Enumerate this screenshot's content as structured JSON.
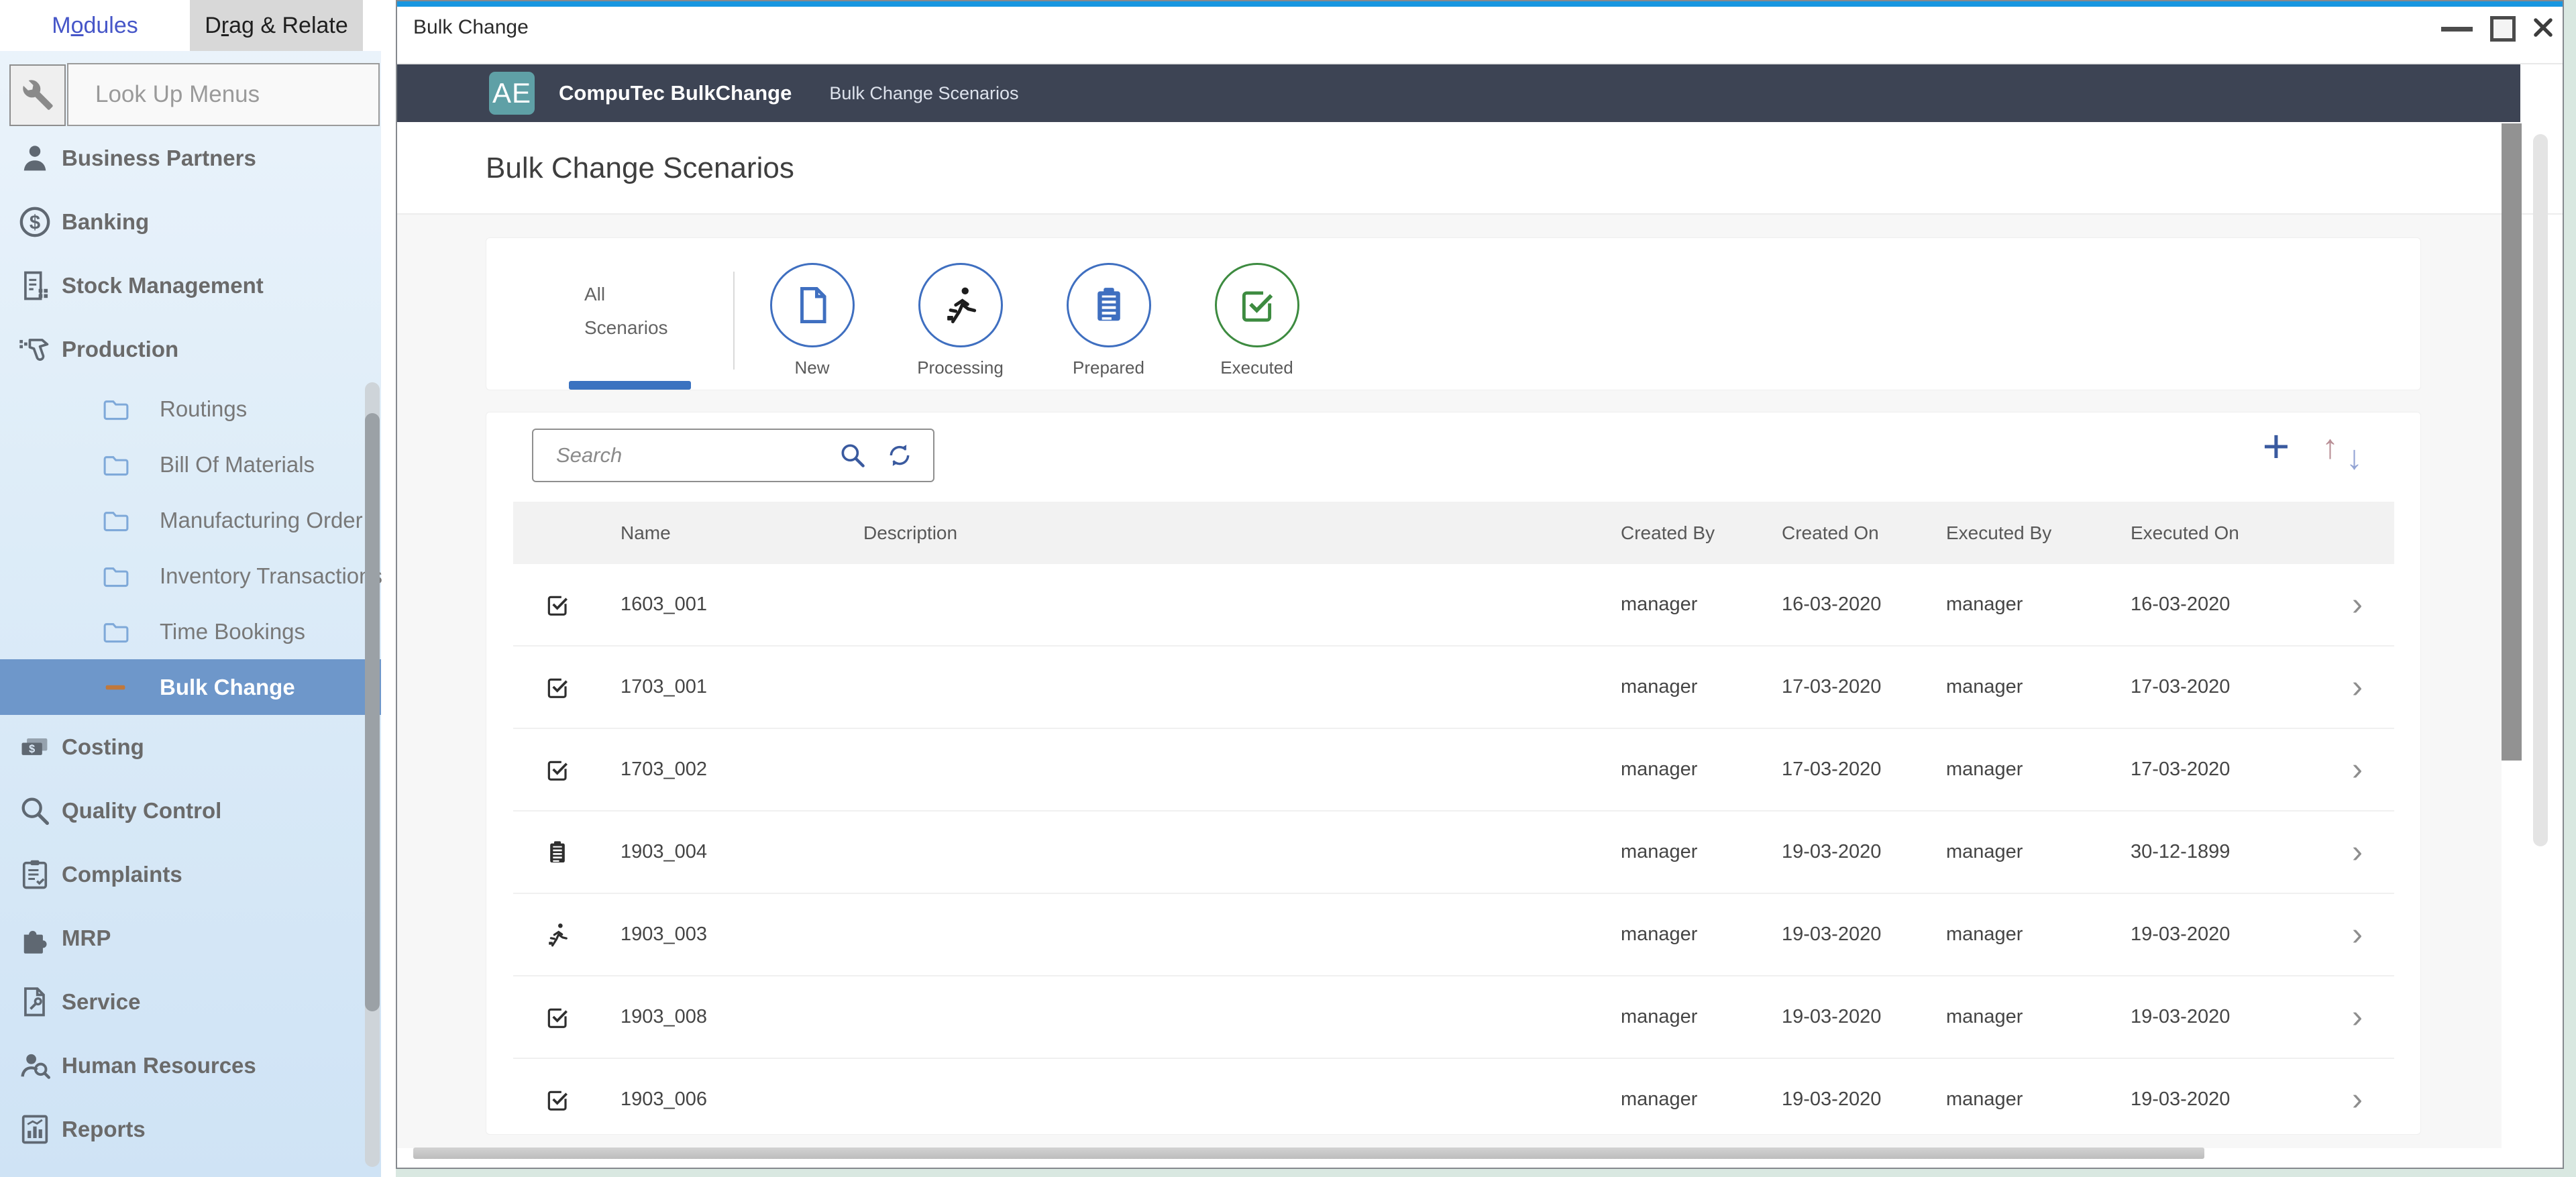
{
  "colors": {
    "accent_blue": "#1896e0",
    "header_dark": "#3d4454",
    "badge_teal": "#5fa0a6",
    "selected_item": "#6e97ca",
    "tab_blue": "#3f6fc0",
    "tab_green": "#3d8b40",
    "active_underline": "#3a72c0",
    "icon_navy": "#3a5a9f",
    "dash_orange": "#c0783c",
    "sidebar_top": "#ecf4fb",
    "sidebar_bottom": "#cfe3f5"
  },
  "sidebar": {
    "tabs": [
      {
        "pre": "M",
        "accel": "o",
        "post": "dules",
        "active": true
      },
      {
        "pre": "D",
        "accel": "r",
        "post": "ag & Relate",
        "active": false
      }
    ],
    "lookup_placeholder": "Look Up Menus",
    "items": [
      {
        "label": "Business Partners",
        "icon": "person",
        "type": "module"
      },
      {
        "label": "Banking",
        "icon": "dollar",
        "type": "module"
      },
      {
        "label": "Stock Management",
        "icon": "stock",
        "type": "module"
      },
      {
        "label": "Production",
        "icon": "production",
        "type": "module"
      },
      {
        "label": "Routings",
        "icon": "folder",
        "type": "sub"
      },
      {
        "label": "Bill Of Materials",
        "icon": "folder",
        "type": "sub"
      },
      {
        "label": "Manufacturing Order",
        "icon": "folder",
        "type": "sub"
      },
      {
        "label": "Inventory Transactions",
        "icon": "folder",
        "type": "sub"
      },
      {
        "label": "Time Bookings",
        "icon": "folder",
        "type": "sub"
      },
      {
        "label": "Bulk Change",
        "icon": "dash",
        "type": "sub",
        "selected": true
      },
      {
        "label": "Costing",
        "icon": "money",
        "type": "module"
      },
      {
        "label": "Quality Control",
        "icon": "magnifier",
        "type": "module"
      },
      {
        "label": "Complaints",
        "icon": "clipboard",
        "type": "module"
      },
      {
        "label": "MRP",
        "icon": "puzzle",
        "type": "module"
      },
      {
        "label": "Service",
        "icon": "service",
        "type": "module"
      },
      {
        "label": "Human Resources",
        "icon": "person-search",
        "type": "module"
      },
      {
        "label": "Reports",
        "icon": "report",
        "type": "module"
      }
    ]
  },
  "window": {
    "title": "Bulk Change",
    "header": {
      "badge": "AE",
      "app_name": "CompuTec BulkChange",
      "breadcrumb": "Bulk Change Scenarios"
    },
    "page_title": "Bulk Change Scenarios",
    "filter_bar": {
      "all_tab": {
        "line1": "All",
        "line2": "Scenarios"
      },
      "tabs": [
        {
          "label": "New",
          "icon": "document",
          "color": "blue"
        },
        {
          "label": "Processing",
          "icon": "runner",
          "color": "blue"
        },
        {
          "label": "Prepared",
          "icon": "clipboard-filled",
          "color": "blue"
        },
        {
          "label": "Executed",
          "icon": "check-square",
          "color": "green"
        }
      ]
    },
    "toolbar": {
      "search_placeholder": "Search",
      "add_icon": "+",
      "sort_up_icon": "↑",
      "sort_down_icon": "↓"
    },
    "table": {
      "columns": [
        "Name",
        "Description",
        "Created By",
        "Created On",
        "Executed By",
        "Executed On"
      ],
      "chevron_icon": "›",
      "rows": [
        {
          "status": "executed",
          "name": "1603_001",
          "description": "",
          "created_by": "manager",
          "created_on": "16-03-2020",
          "executed_by": "manager",
          "executed_on": "16-03-2020"
        },
        {
          "status": "executed",
          "name": "1703_001",
          "description": "",
          "created_by": "manager",
          "created_on": "17-03-2020",
          "executed_by": "manager",
          "executed_on": "17-03-2020"
        },
        {
          "status": "executed",
          "name": "1703_002",
          "description": "",
          "created_by": "manager",
          "created_on": "17-03-2020",
          "executed_by": "manager",
          "executed_on": "17-03-2020"
        },
        {
          "status": "prepared",
          "name": "1903_004",
          "description": "",
          "created_by": "manager",
          "created_on": "19-03-2020",
          "executed_by": "manager",
          "executed_on": "30-12-1899"
        },
        {
          "status": "processing",
          "name": "1903_003",
          "description": "",
          "created_by": "manager",
          "created_on": "19-03-2020",
          "executed_by": "manager",
          "executed_on": "19-03-2020"
        },
        {
          "status": "executed",
          "name": "1903_008",
          "description": "",
          "created_by": "manager",
          "created_on": "19-03-2020",
          "executed_by": "manager",
          "executed_on": "19-03-2020"
        },
        {
          "status": "executed",
          "name": "1903_006",
          "description": "",
          "created_by": "manager",
          "created_on": "19-03-2020",
          "executed_by": "manager",
          "executed_on": "19-03-2020"
        }
      ]
    }
  }
}
